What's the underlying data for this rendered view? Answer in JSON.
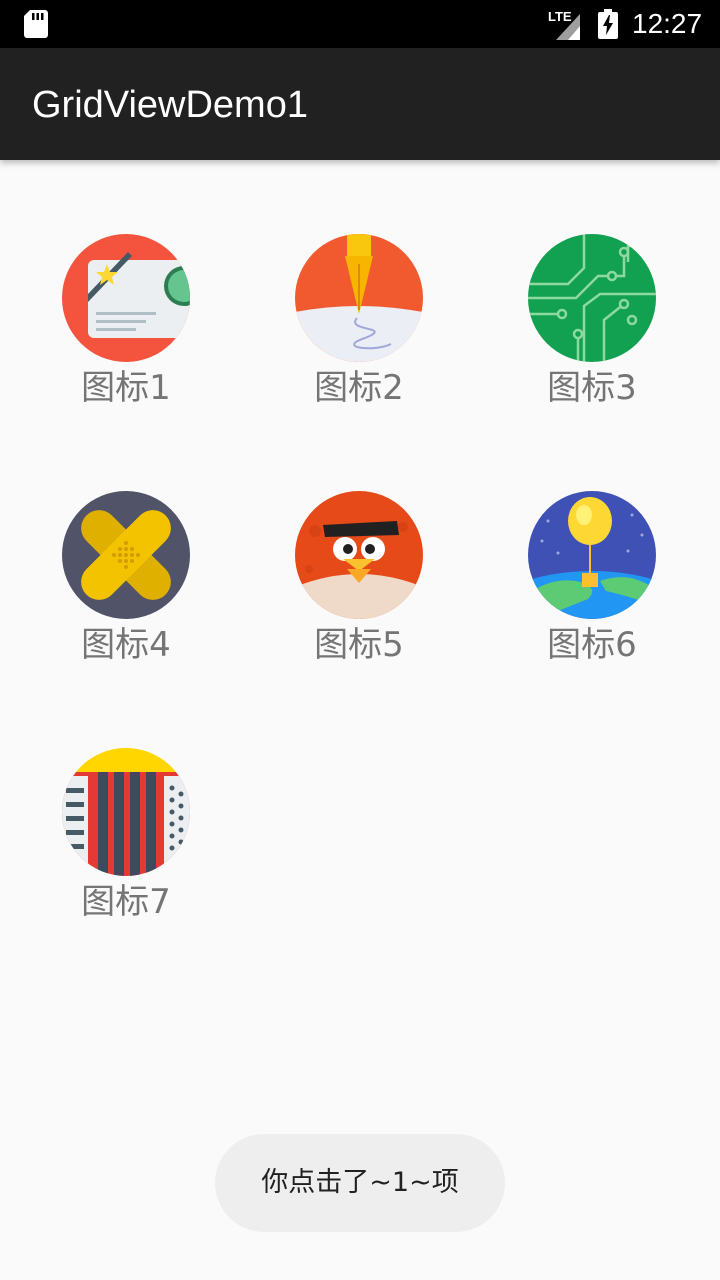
{
  "status_bar": {
    "time": "12:27",
    "network_label": "LTE",
    "icons": [
      "sd-card-icon",
      "signal-icon",
      "battery-charging-icon"
    ]
  },
  "app_bar": {
    "title": "GridViewDemo1"
  },
  "grid": {
    "items": [
      {
        "label": "图标1",
        "icon": "id-card-icon"
      },
      {
        "label": "图标2",
        "icon": "fountain-pen-icon"
      },
      {
        "label": "图标3",
        "icon": "circuit-board-icon"
      },
      {
        "label": "图标4",
        "icon": "bandage-icon"
      },
      {
        "label": "图标5",
        "icon": "angry-bird-icon"
      },
      {
        "label": "图标6",
        "icon": "balloon-earth-icon"
      },
      {
        "label": "图标7",
        "icon": "accordion-icon"
      }
    ]
  },
  "toast": {
    "message": "你点击了~1~项"
  },
  "colors": {
    "status_bar": "#000000",
    "app_bar": "#212121",
    "background": "#fafafa",
    "label": "#757575",
    "toast_bg": "#eeeeee"
  }
}
